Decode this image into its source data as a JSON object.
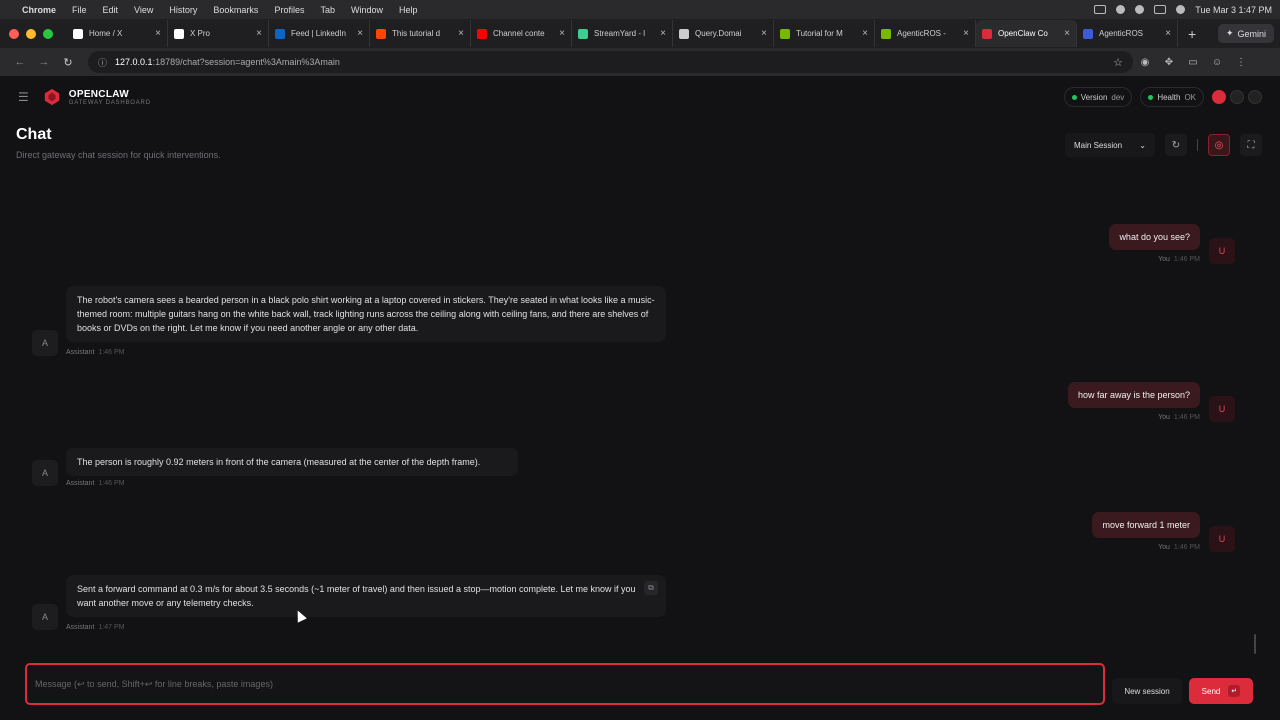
{
  "menubar": {
    "app": "Chrome",
    "items": [
      "File",
      "Edit",
      "View",
      "History",
      "Bookmarks",
      "Profiles",
      "Tab",
      "Window",
      "Help"
    ],
    "clock": "Tue Mar 3  1:47 PM"
  },
  "tabs": [
    {
      "label": "Home / X",
      "color": "#ffffff"
    },
    {
      "label": "X Pro",
      "color": "#ffffff"
    },
    {
      "label": "Feed | LinkedIn",
      "color": "#0a66c2"
    },
    {
      "label": "This tutorial d",
      "color": "#ff4500"
    },
    {
      "label": "Channel conte",
      "color": "#ff0000"
    },
    {
      "label": "StreamYard - l",
      "color": "#3ecf8e"
    },
    {
      "label": "Query.Domai",
      "color": "#cccccc"
    },
    {
      "label": "Tutorial for M",
      "color": "#76b900"
    },
    {
      "label": "AgenticROS -",
      "color": "#76b900"
    },
    {
      "label": "OpenClaw Co",
      "color": "#dc2b3a"
    },
    {
      "label": "AgenticROS",
      "color": "#3b5bdb"
    }
  ],
  "gemini_label": "Gemini",
  "address": {
    "host": "127.0.0.1",
    "path": ":18789/chat?session=agent%3Amain%3Amain"
  },
  "app": {
    "name": "OPENCLAW",
    "subtitle": "GATEWAY DASHBOARD",
    "accent": "#dc2b3a"
  },
  "status": {
    "version_label": "Version",
    "version_value": "dev",
    "health_label": "Health",
    "health_value": "OK"
  },
  "page": {
    "title": "Chat",
    "subtitle": "Direct gateway chat session for quick interventions."
  },
  "session_select": "Main Session",
  "messages": [
    {
      "role": "user",
      "text": "what do you see?",
      "sender": "You",
      "time": "1:46 PM",
      "avatar": "U"
    },
    {
      "role": "assistant",
      "text": "The robot's camera sees a bearded person in a black polo shirt working at a laptop covered in stickers. They're seated in what looks like a music-themed room: multiple guitars hang on the white back wall, track lighting runs across the ceiling along with ceiling fans, and there are shelves of books or DVDs on the right. Let me know if you need another angle or any other data.",
      "sender": "Assistant",
      "time": "1:46 PM",
      "avatar": "A"
    },
    {
      "role": "user",
      "text": "how far away is the person?",
      "sender": "You",
      "time": "1:46 PM",
      "avatar": "U"
    },
    {
      "role": "assistant",
      "text": "The person is roughly 0.92 meters in front of the camera (measured at the center of the depth frame).",
      "sender": "Assistant",
      "time": "1:46 PM",
      "avatar": "A"
    },
    {
      "role": "user",
      "text": "move forward 1 meter",
      "sender": "You",
      "time": "1:46 PM",
      "avatar": "U"
    },
    {
      "role": "assistant",
      "text": "Sent a forward command at 0.3 m/s for about 3.5 seconds (~1 meter of travel) and then issued a stop—motion complete. Let me know if you want another move or any telemetry checks.",
      "sender": "Assistant",
      "time": "1:47 PM",
      "avatar": "A"
    }
  ],
  "composer": {
    "placeholder": "Message (↩ to send, Shift+↩ for line breaks, paste images)",
    "new_session": "New session",
    "send": "Send"
  }
}
